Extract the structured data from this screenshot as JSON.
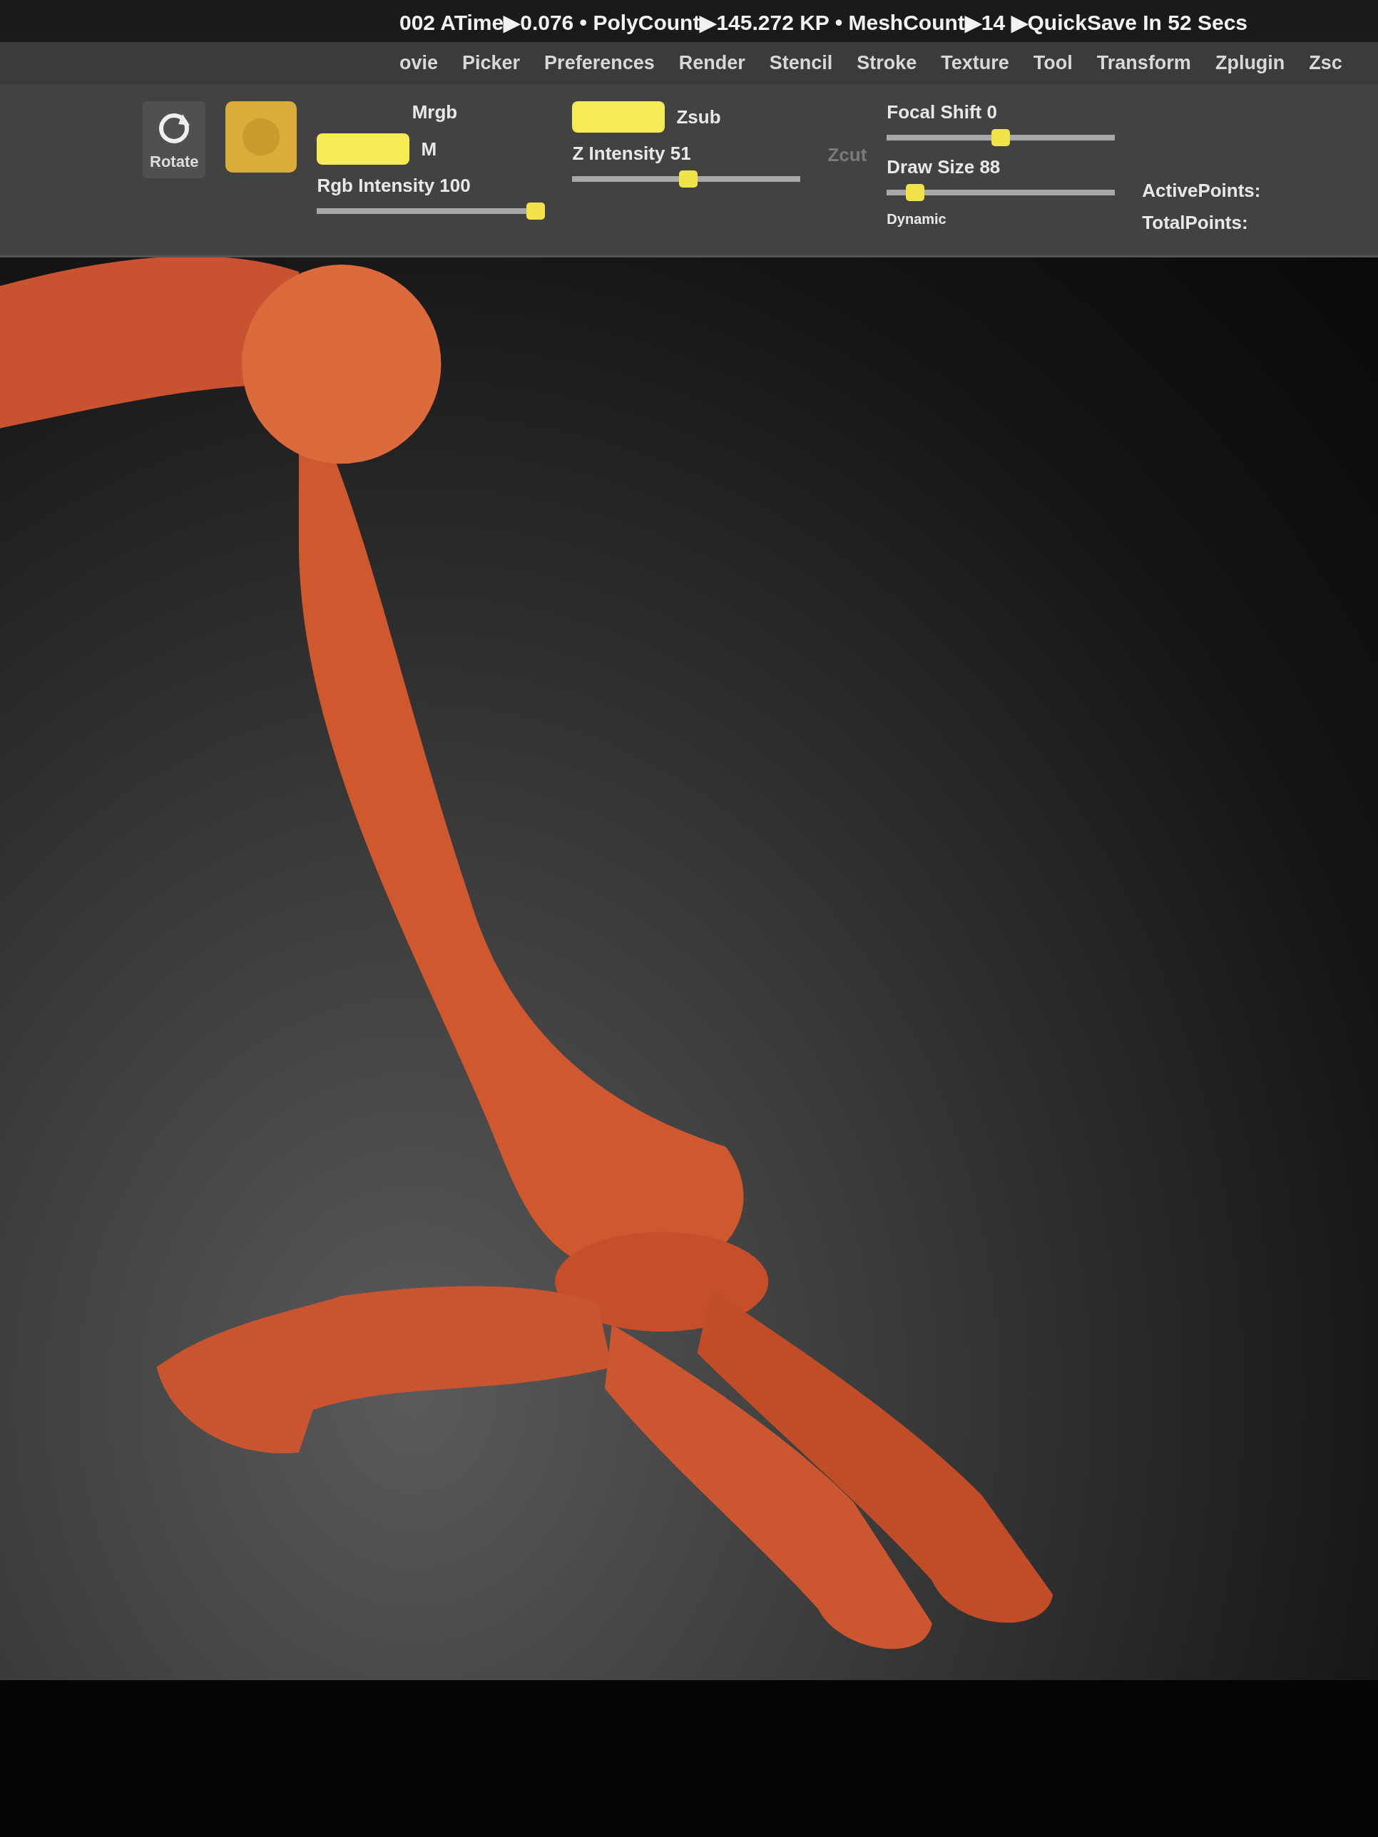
{
  "status_bar": {
    "text": "002 ATime▶0.076 • PolyCount▶145.272 KP • MeshCount▶14 ▶QuickSave In 52 Secs"
  },
  "menus": [
    {
      "label": "ovie"
    },
    {
      "label": "Picker"
    },
    {
      "label": "Preferences"
    },
    {
      "label": "Render"
    },
    {
      "label": "Stencil"
    },
    {
      "label": "Stroke"
    },
    {
      "label": "Texture"
    },
    {
      "label": "Tool"
    },
    {
      "label": "Transform"
    },
    {
      "label": "Zplugin"
    },
    {
      "label": "Zsc"
    }
  ],
  "shelf": {
    "rotate_button": {
      "label": "Rotate"
    },
    "rgb_group": {
      "mrgb": "Mrgb",
      "rgb_on": true,
      "m": "M"
    },
    "z_group": {
      "zadd_on": true,
      "zsub": "Zsub",
      "zcut": "Zcut",
      "zcut_disabled": true
    },
    "sliders": [
      {
        "label": "Rgb Intensity 100",
        "level": 1
      },
      {
        "label": "Z Intensity 51",
        "level": 0.51
      },
      {
        "label": "Focal Shift 0",
        "level": 0.5
      },
      {
        "label": "Draw Size 88",
        "level": 0.09
      }
    ],
    "dynamic": "Dynamic",
    "points": [
      "ActivePoints:",
      "TotalPoints:"
    ]
  }
}
